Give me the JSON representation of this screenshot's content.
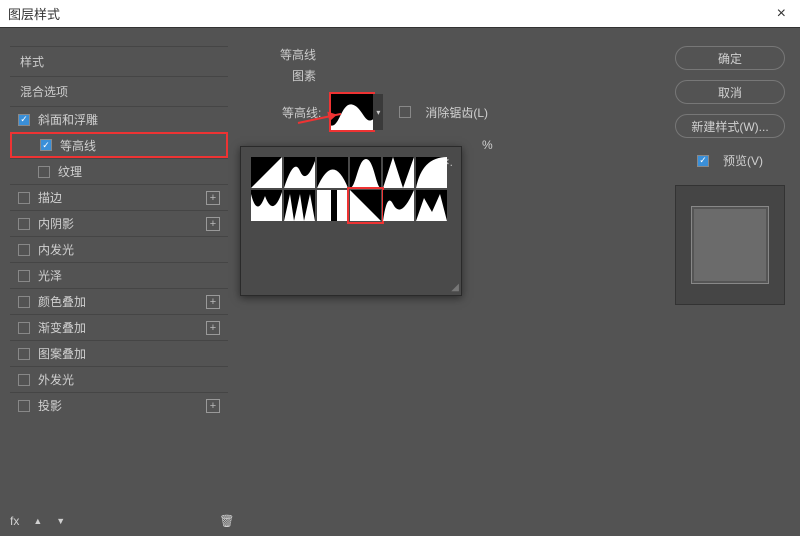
{
  "titlebar": {
    "title": "图层样式",
    "close": "×"
  },
  "left": {
    "header_style": "样式",
    "header_blend": "混合选项",
    "items": [
      {
        "label": "斜面和浮雕",
        "checked": true,
        "plus": false,
        "sub": false
      },
      {
        "label": "等高线",
        "checked": true,
        "plus": false,
        "sub": true,
        "highlight": true
      },
      {
        "label": "纹理",
        "checked": false,
        "plus": false,
        "sub": true
      },
      {
        "label": "描边",
        "checked": false,
        "plus": true,
        "sub": false
      },
      {
        "label": "内阴影",
        "checked": false,
        "plus": true,
        "sub": false
      },
      {
        "label": "内发光",
        "checked": false,
        "plus": false,
        "sub": false
      },
      {
        "label": "光泽",
        "checked": false,
        "plus": false,
        "sub": false
      },
      {
        "label": "颜色叠加",
        "checked": false,
        "plus": true,
        "sub": false
      },
      {
        "label": "渐变叠加",
        "checked": false,
        "plus": true,
        "sub": false
      },
      {
        "label": "图案叠加",
        "checked": false,
        "plus": false,
        "sub": false
      },
      {
        "label": "外发光",
        "checked": false,
        "plus": false,
        "sub": false
      },
      {
        "label": "投影",
        "checked": false,
        "plus": true,
        "sub": false
      }
    ],
    "tools": {
      "fx": "fx",
      "up": "▲",
      "down": "▼",
      "trash": "🗑"
    }
  },
  "center": {
    "group_title": "等高线",
    "group_sub": "图素",
    "contour_label": "等高线:",
    "antialias_label": "消除锯齿(L)",
    "range_pct": "%"
  },
  "right": {
    "ok": "确定",
    "cancel": "取消",
    "newstyle": "新建样式(W)...",
    "preview_label": "预览(V)"
  },
  "popup": {
    "gear": "✲."
  }
}
